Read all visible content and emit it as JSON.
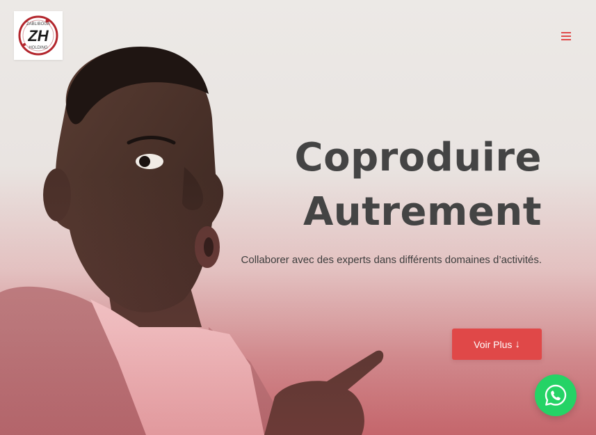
{
  "header": {
    "logo": {
      "monogram": "ZH",
      "top_text": "ZABLIBOGA",
      "bottom_text": "HOLDING",
      "icon": "brand-logo"
    },
    "menu_icon": "hamburger-menu-icon"
  },
  "hero": {
    "title_line1": "Coproduire",
    "title_line2": "Autrement",
    "subtitle": "Collaborer avec des experts dans différents domaines d’activités.",
    "cta_label": "Voir Plus",
    "cta_icon": "arrow-down-icon"
  },
  "floating": {
    "chat_icon": "whatsapp-icon"
  },
  "colors": {
    "accent": "#e04848",
    "title": "#444444",
    "text": "#3d3d3d",
    "whatsapp": "#25d366"
  }
}
